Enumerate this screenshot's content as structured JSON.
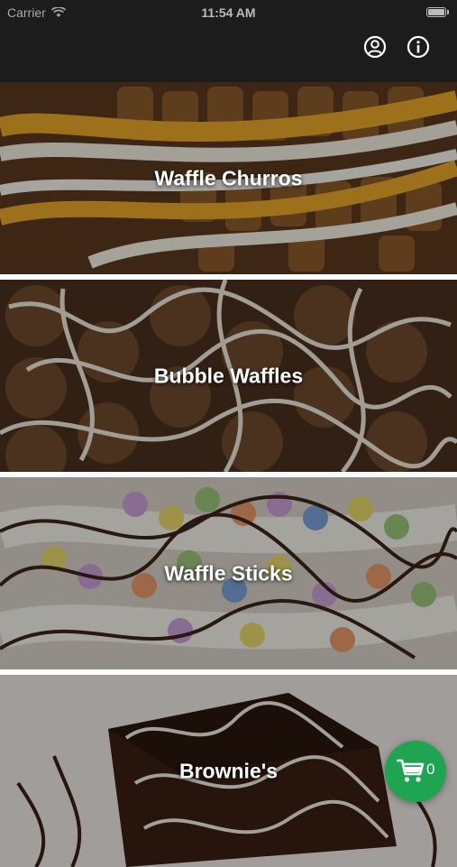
{
  "status_bar": {
    "carrier": "Carrier",
    "time": "11:54 AM"
  },
  "nav": {
    "account_icon": "account-circle-icon",
    "info_icon": "info-circle-icon"
  },
  "categories": [
    {
      "label": "Waffle Churros"
    },
    {
      "label": "Bubble Waffles"
    },
    {
      "label": "Waffle Sticks"
    },
    {
      "label": "Brownie's"
    }
  ],
  "cart": {
    "count": "0",
    "icon": "shopping-cart-icon",
    "color": "#1fa451"
  }
}
